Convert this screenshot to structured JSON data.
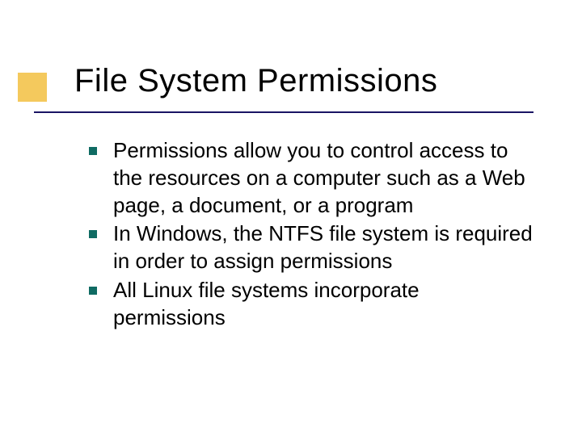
{
  "slide": {
    "title": "File System Permissions",
    "bullets": [
      {
        "text": "Permissions allow you to control access to the resources on a computer such as a Web page, a document, or a program"
      },
      {
        "text": "In Windows, the NTFS file system is required in order to assign permissions"
      },
      {
        "text": "All Linux file systems incorporate permissions"
      }
    ]
  }
}
